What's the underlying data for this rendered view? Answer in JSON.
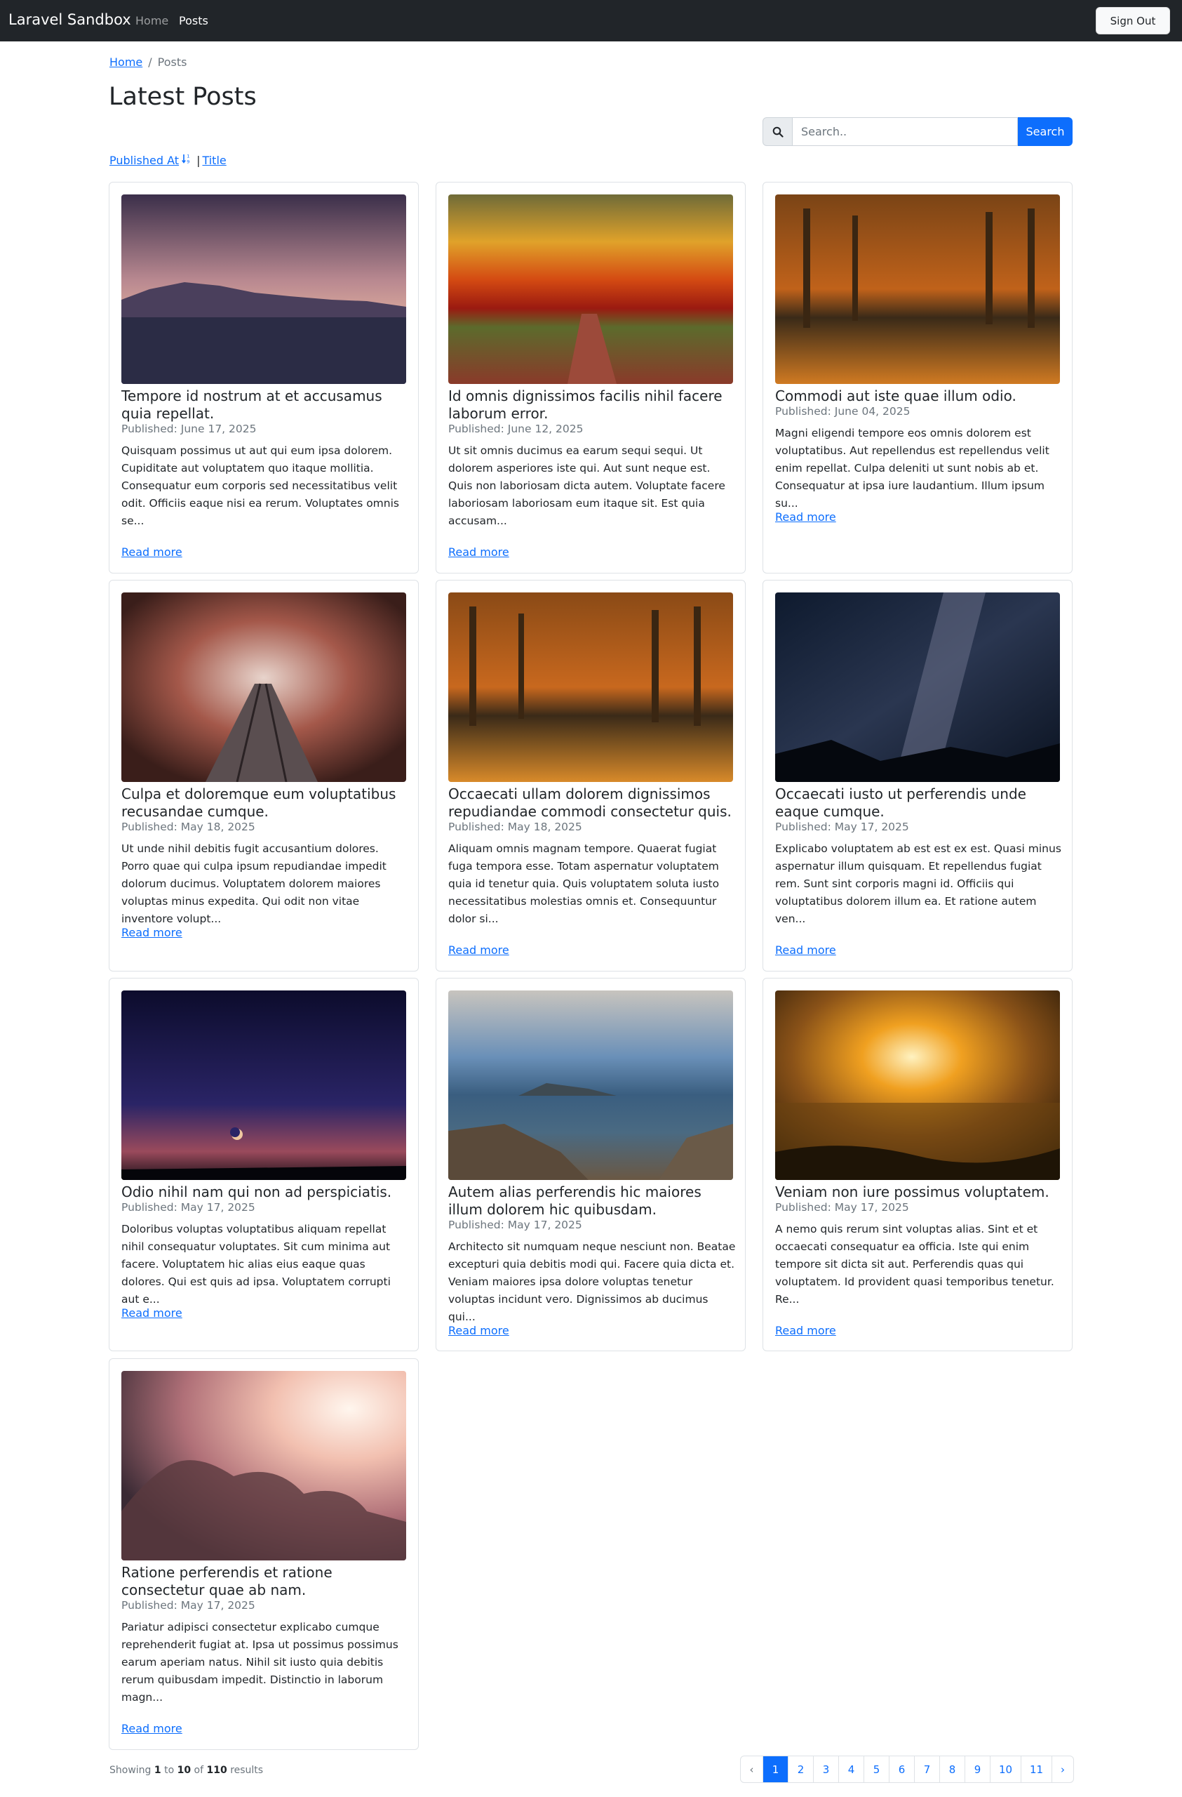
{
  "navbar": {
    "brand": "Laravel Sandbox",
    "links": [
      "Home",
      "Posts"
    ],
    "signout_label": "Sign Out"
  },
  "breadcrumb": {
    "home": "Home",
    "separator": "/",
    "current": "Posts"
  },
  "page_title": "Latest Posts",
  "search": {
    "placeholder": "Search..",
    "button_label": "Search",
    "icon": "search-icon"
  },
  "sort": {
    "published_at": "Published At",
    "separator": "|",
    "title": "Title",
    "icon": "sort-numeric-down-icon"
  },
  "posts": [
    {
      "title": "Tempore id nostrum at et accusamus quia repellat.",
      "date": "Published: June 17, 2025",
      "excerpt": "Quisquam possimus ut aut qui eum ipsa dolorem. Cupiditate aut voluptatem quo itaque mollitia. Consequatur eum corporis sed necessitatibus velit odit. Officiis eaque nisi ea rerum. Voluptates omnis se...",
      "read_more": "Read more"
    },
    {
      "title": "Id omnis dignissimos facilis nihil facere laborum error.",
      "date": "Published: June 12, 2025",
      "excerpt": "Ut sit omnis ducimus ea earum sequi sequi. Ut dolorem asperiores iste qui. Aut sunt neque est. Quis non laboriosam dicta autem. Voluptate facere laboriosam laboriosam eum itaque sit. Est quia accusam...",
      "read_more": "Read more"
    },
    {
      "title": "Commodi aut iste quae illum odio.",
      "date": "Published: June 04, 2025",
      "excerpt": "Magni eligendi tempore eos omnis dolorem est voluptatibus. Aut repellendus est repellendus velit enim repellat. Culpa deleniti ut sunt nobis ab et. Consequatur at ipsa iure laudantium. Illum ipsum su...",
      "read_more": "Read more"
    },
    {
      "title": "Culpa et doloremque eum voluptatibus recusandae cumque.",
      "date": "Published: May 18, 2025",
      "excerpt": "Ut unde nihil debitis fugit accusantium dolores. Porro quae qui culpa ipsum repudiandae impedit dolorum ducimus. Voluptatem dolorem maiores voluptas minus expedita. Qui odit non vitae inventore volupt...",
      "read_more": "Read more"
    },
    {
      "title": "Occaecati ullam dolorem dignissimos repudiandae commodi consectetur quis.",
      "date": "Published: May 18, 2025",
      "excerpt": "Aliquam omnis magnam tempore. Quaerat fugiat fuga tempora esse. Totam aspernatur voluptatem quia id tenetur quia. Quis voluptatem soluta iusto necessitatibus molestias omnis et. Consequuntur dolor si...",
      "read_more": "Read more"
    },
    {
      "title": "Occaecati iusto ut perferendis unde eaque cumque.",
      "date": "Published: May 17, 2025",
      "excerpt": "Explicabo voluptatem ab est est ex est. Quasi minus aspernatur illum quisquam. Et repellendus fugiat rem. Sunt sint corporis magni id. Officiis qui voluptatibus dolorem illum ea. Et ratione autem ven...",
      "read_more": "Read more"
    },
    {
      "title": "Odio nihil nam qui non ad perspiciatis.",
      "date": "Published: May 17, 2025",
      "excerpt": "Doloribus voluptas voluptatibus aliquam repellat nihil consequatur voluptates. Sit cum minima aut facere. Voluptatem hic alias eius eaque quas dolores. Qui est quis ad ipsa. Voluptatem corrupti aut e...",
      "read_more": "Read more"
    },
    {
      "title": "Autem alias perferendis hic maiores illum dolorem hic quibusdam.",
      "date": "Published: May 17, 2025",
      "excerpt": "Architecto sit numquam neque nesciunt non. Beatae excepturi quia debitis modi qui. Facere quia dicta et. Veniam maiores ipsa dolore voluptas tenetur voluptas incidunt vero. Dignissimos ab ducimus qui...",
      "read_more": "Read more"
    },
    {
      "title": "Veniam non iure possimus voluptatem.",
      "date": "Published: May 17, 2025",
      "excerpt": "A nemo quis rerum sint voluptas alias. Sint et et occaecati consequatur ea officia. Iste qui enim tempore sit dicta sit aut. Perferendis quas qui voluptatem. Id provident quasi temporibus tenetur. Re...",
      "read_more": "Read more"
    },
    {
      "title": "Ratione perferendis et ratione consectetur quae ab nam.",
      "date": "Published: May 17, 2025",
      "excerpt": "Pariatur adipisci consectetur explicabo cumque reprehenderit fugiat at. Ipsa ut possimus possimus earum aperiam natus. Nihil sit iusto quia debitis rerum quibusdam impedit. Distinctio in laborum magn...",
      "read_more": "Read more"
    }
  ],
  "footer": {
    "showing": "Showing",
    "from": "1",
    "to_word": "to",
    "to": "10",
    "of_word": "of",
    "total": "110",
    "results_word": "results"
  },
  "pagination": {
    "prev": "‹",
    "pages": [
      "1",
      "2",
      "3",
      "4",
      "5",
      "6",
      "7",
      "8",
      "9",
      "10",
      "11"
    ],
    "next": "›",
    "active_page": "1"
  }
}
